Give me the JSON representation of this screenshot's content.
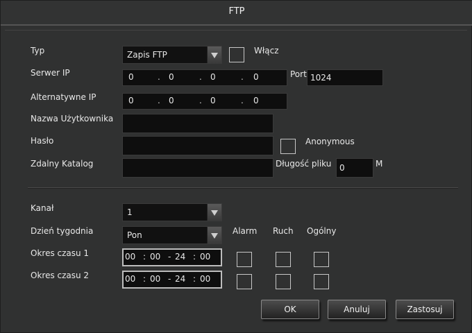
{
  "dialog": {
    "title": "FTP"
  },
  "form": {
    "typ_label": "Typ",
    "typ_value": "Zapis FTP",
    "enable_label": "Włącz",
    "server_ip_label": "Serwer IP",
    "server_ip": [
      "0",
      "0",
      "0",
      "0"
    ],
    "port_label": "Port",
    "port_value": "1024",
    "alt_ip_label": "Alternatywne IP",
    "alt_ip": [
      "0",
      "0",
      "0",
      "0"
    ],
    "ip_sep": ".",
    "username_label": "Nazwa Użytkownika",
    "username_value": "",
    "password_label": "Hasło",
    "password_value": "",
    "anonymous_label": "Anonymous",
    "remote_dir_label": "Zdalny Katalog",
    "remote_dir_value": "",
    "file_length_label": "Długość pliku",
    "file_length_value": "0",
    "file_length_unit": "M"
  },
  "schedule": {
    "channel_label": "Kanał",
    "channel_value": "1",
    "weekday_label": "Dzień tygodnia",
    "weekday_value": "Pon",
    "col_alarm": "Alarm",
    "col_motion": "Ruch",
    "col_general": "Ogólny",
    "periods": [
      {
        "label": "Okres czasu 1",
        "start_h": "00",
        "start_m": "00",
        "end_h": "24",
        "end_m": "00"
      },
      {
        "label": "Okres czasu 2",
        "start_h": "00",
        "start_m": "00",
        "end_h": "24",
        "end_m": "00"
      }
    ],
    "time_sep": ":",
    "range_sep": "-"
  },
  "buttons": {
    "ok": "OK",
    "cancel": "Anuluj",
    "apply": "Zastosuj"
  },
  "colors": {
    "background": "#303131",
    "field": "#0e0e0e",
    "text": "#e8e8e8"
  }
}
